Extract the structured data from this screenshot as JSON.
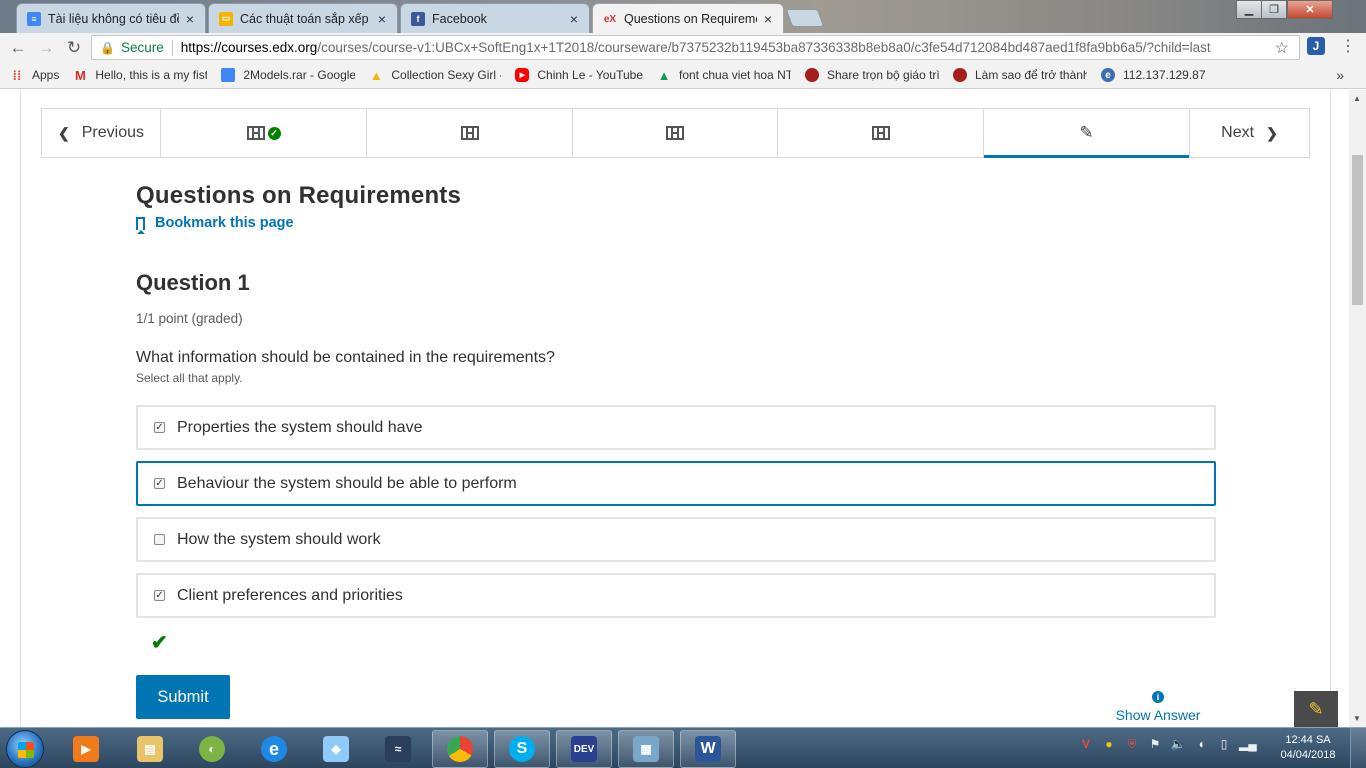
{
  "browser": {
    "tabs": [
      {
        "title": "Tài liệu không có tiêu đề",
        "close": "×",
        "icon": "google-docs-icon",
        "icon_color": "#4285f4"
      },
      {
        "title": "Các thuật toán sắp xếp -",
        "close": "×",
        "icon": "google-slides-icon",
        "icon_color": "#f4b400"
      },
      {
        "title": "Facebook",
        "close": "×",
        "icon": "facebook-icon",
        "icon_color": "#3b5998"
      },
      {
        "title": "Questions on Requireme",
        "close": "×",
        "icon": "edx-icon",
        "icon_color": "#d12f3d"
      }
    ],
    "secure_label": "Secure",
    "url_host": "https://courses.edx.org",
    "url_rest": "/courses/course-v1:UBCx+SoftEng1x+1T2018/courseware/b7375232b119453ba87336338b8eb8a0/c3fe54d712084bd487aed1f8fa9bb6a5/?child=last",
    "bookmarks": [
      {
        "label": "Apps",
        "icon": "apps-grid-icon",
        "color": "#ea4335"
      },
      {
        "label": "Hello, this is a my fist",
        "icon": "gmail-icon",
        "color": "#d93025"
      },
      {
        "label": "2Models.rar - Google",
        "icon": "google-docs-icon",
        "color": "#4285f4"
      },
      {
        "label": "Collection Sexy Girl -",
        "icon": "google-drive-icon",
        "color": "#f4b400"
      },
      {
        "label": "Chinh Le - YouTube",
        "icon": "youtube-icon",
        "color": "#ff0000"
      },
      {
        "label": "font chua viet hoa NT",
        "icon": "google-drive-icon",
        "color": "#0f9d58"
      },
      {
        "label": "Share trọn bộ giáo trì",
        "icon": "site-icon",
        "color": "#a41e1e"
      },
      {
        "label": "Làm sao để trở thành",
        "icon": "site-icon",
        "color": "#a41e1e"
      },
      {
        "label": "112.137.129.87",
        "icon": "globe-icon",
        "color": "#3a6fb0"
      }
    ],
    "bookmarks_more": "»"
  },
  "seqnav": {
    "previous": "Previous",
    "next": "Next",
    "units": [
      {
        "type": "video",
        "completed": true
      },
      {
        "type": "video",
        "completed": false
      },
      {
        "type": "video",
        "completed": false
      },
      {
        "type": "video",
        "completed": false
      },
      {
        "type": "problem",
        "active": true
      }
    ]
  },
  "page": {
    "title": "Questions on Requirements",
    "bookmark": "Bookmark this page"
  },
  "question": {
    "heading": "Question 1",
    "points": "1/1 point (graded)",
    "text": "What information should be contained in the requirements?",
    "hint": "Select all that apply.",
    "choices": [
      {
        "label": "Properties the system should have",
        "checked": true
      },
      {
        "label": "Behaviour the system should be able to perform",
        "checked": true,
        "focused": true
      },
      {
        "label": "How the system should work",
        "checked": false
      },
      {
        "label": "Client preferences and priorities",
        "checked": true
      }
    ],
    "status": "correct",
    "submit": "Submit",
    "show_answer": "Show Answer"
  },
  "taskbar": {
    "clock_time": "12:44 SA",
    "clock_date": "04/04/2018"
  },
  "colors": {
    "accent": "#0075b4",
    "success": "#008100",
    "text": "#313131"
  }
}
